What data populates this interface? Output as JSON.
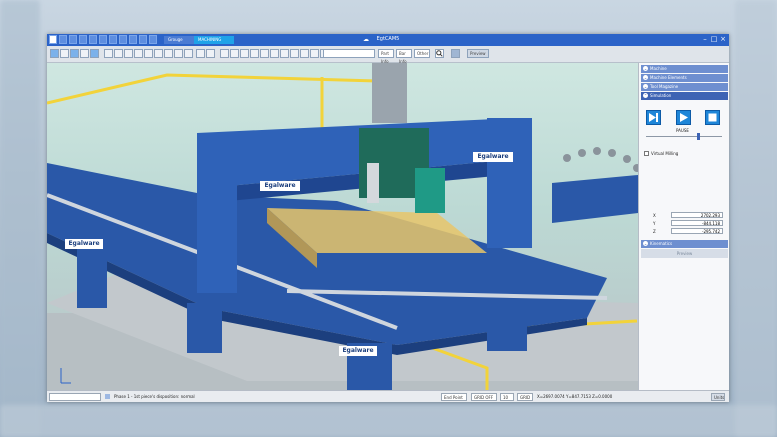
{
  "window": {
    "title": "EgtCAM5",
    "badge_left": "Grouge",
    "badge_right": "MACHINING",
    "minimize": "–",
    "maximize": "□",
    "close": "×"
  },
  "toolbar": {
    "field_labels": [
      "Part Info",
      "Bar Info",
      "Other"
    ],
    "search_icon": "search-icon",
    "button_right": "Preview"
  },
  "viewport": {
    "brand_labels": [
      "Egalware",
      "Egalware",
      "Egalware",
      "Egalware"
    ],
    "axis_indicator": "axis-triad-icon"
  },
  "panel": {
    "sections": [
      "Machine",
      "Machine Elements",
      "Tool Magazine",
      "Simulation",
      "Kinematics"
    ],
    "pause_label": "PAUSE",
    "virtual_milling_label": "Virtual Milling",
    "virtual_milling_checked": false,
    "speed_level": 0.68,
    "coordinates": [
      {
        "label": "X",
        "value": "2702.293"
      },
      {
        "label": "Y",
        "value": "-844.118"
      },
      {
        "label": "Z",
        "value": "-295.742"
      }
    ],
    "bottom_button": "Preview"
  },
  "statusbar": {
    "phase_text": "Phase 1 - 1st piece's disposition: normal",
    "snap_label": "End Point",
    "grid_toggle": "GRID OFF",
    "grid_value": "10",
    "grid_label": "GRID",
    "cursor_coords": "X=2697.0074 Y=847.7153 Z=0.0000",
    "right_button": "Units"
  },
  "colors": {
    "titlebar": "#2b63c8",
    "machine_blue": "#2a58a8",
    "rail_yellow": "#f2d33a",
    "panel_section": "#6e8fd0",
    "play_blue": "#1e86d8"
  }
}
